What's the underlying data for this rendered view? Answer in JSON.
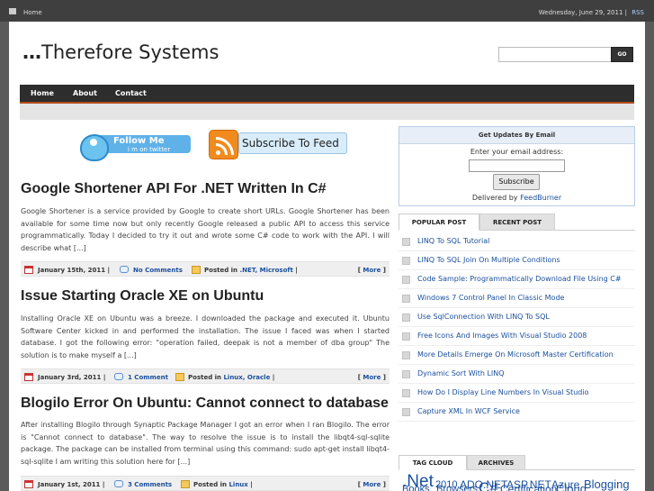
{
  "topbar": {
    "home_label": "Home",
    "date": "Wednesday, June 29, 2011 |",
    "rss_label": "RSS"
  },
  "site": {
    "logo_prefix": "…",
    "logo_name": "Therefore Systems"
  },
  "search": {
    "placeholder": "",
    "button_label": "GO"
  },
  "nav": {
    "items": [
      "Home",
      "About",
      "Contact"
    ]
  },
  "banners": {
    "twitter_line1": "Follow Me",
    "twitter_line2": "i m on twitter",
    "feed_label": "Subscribe To Feed"
  },
  "posts": [
    {
      "title": "Google Shortener API For .NET Written In C#",
      "excerpt": "Google Shortener is a service provided by Google to create short URLs. Google Shortener has been available for some time now but only recently Google released a public API to access this service programmatically. Today I decided to try it out and wrote some C# code to work with the API. I will describe what [...]",
      "date": "January 15th, 2011 |",
      "comments": "No Comments",
      "posted_in_prefix": "Posted in",
      "categories": ".NET, Microsoft",
      "posted_in_suffix": "|",
      "more": "More"
    },
    {
      "title": "Issue Starting Oracle XE on Ubuntu",
      "excerpt": "Installing Oracle XE on Ubuntu was a breeze. I downloaded the package and executed it. Ubuntu Software Center kicked in and performed the installation. The issue I faced was when I started database. I got the following error: \"operation failed, deepak is not a member of dba group\" The solution is to make myself a [...]",
      "date": "January 3rd, 2011 |",
      "comments": "1 Comment",
      "posted_in_prefix": "Posted in",
      "categories": "Linux, Oracle",
      "posted_in_suffix": "|",
      "more": "More"
    },
    {
      "title": "Blogilo Error On Ubuntu: Cannot connect to database",
      "excerpt": "After installing Blogilo through Synaptic Package Manager I got an error when I ran Blogilo. The error is \"Cannot connect to database\". The way to resolve the issue is to install the libqt4-sql-sqlite package. The package can be installed from terminal using this command: sudo apt-get install libqt4-sql-sqlite I am writing this solution here for [...]",
      "date": "January 1st, 2011 |",
      "comments": "3 Comments",
      "posted_in_prefix": "Posted in",
      "categories": "Linux",
      "posted_in_suffix": "|",
      "more": "More"
    }
  ],
  "updates": {
    "heading": "Get Updates By Email",
    "label": "Enter your email address:",
    "email_value": "",
    "subscribe_label": "Subscribe",
    "delivered_prefix": "Delivered by",
    "delivered_link": "FeedBurner"
  },
  "sidebar_tabs": {
    "popular": "POPULAR POST",
    "recent": "RECENT POST"
  },
  "popular_posts": [
    "LINQ To SQL Tutorial",
    "LINQ To SQL Join On Multiple Conditions",
    "Code Sample: Programmatically Download File Using C#",
    "Windows 7 Control Panel In Classic Mode",
    "Use SqlConnection With LINQ To SQL",
    "Free Icons And Images With Visual Studio 2008",
    "More Details Emerge On Microsoft Master Certification",
    "Dynamic Sort With LINQ",
    "How Do I Display Line Numbers In Visual Studio",
    "Capture XML In WCF Service"
  ],
  "cloud_tabs": {
    "tag_cloud": "TAG CLOUD",
    "archives": "ARCHIVES"
  },
  "tags": [
    ".Net",
    "2010",
    "ADO.NET",
    "ASP.NET",
    "Azure",
    "Blogging",
    "Books",
    "Browsers",
    "C#",
    "Certification",
    "Cloud"
  ],
  "colors": {
    "accent_line": "#b24a1a",
    "link": "#1a4f9c",
    "nav_bg": "#2d2d2d"
  }
}
